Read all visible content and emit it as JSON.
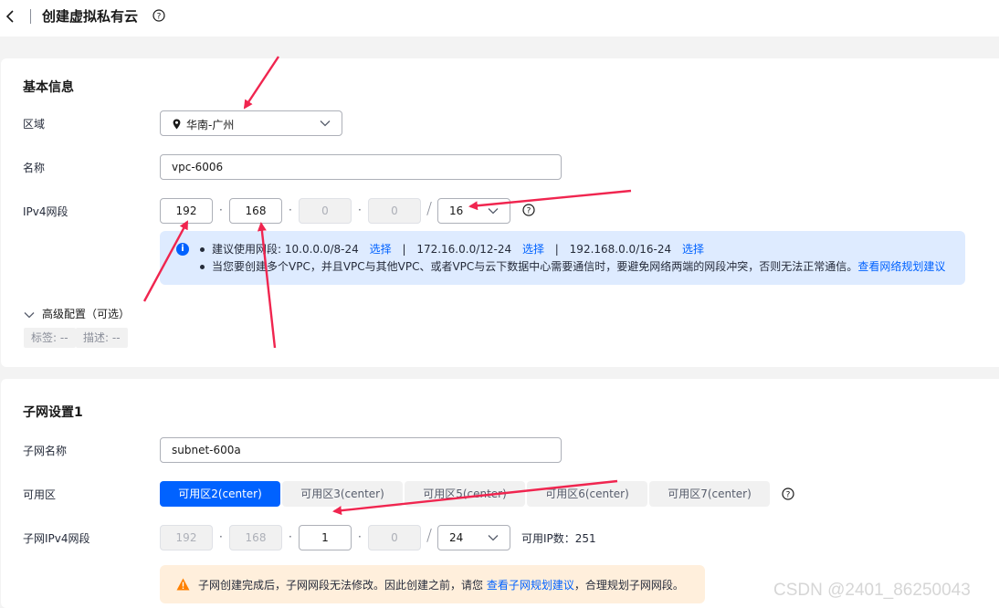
{
  "header": {
    "title": "创建虚拟私有云"
  },
  "basic": {
    "section_title": "基本信息",
    "region_label": "区域",
    "region_value": "华南-广州",
    "name_label": "名称",
    "name_value": "vpc-6006",
    "ipv4_label": "IPv4网段",
    "octets": [
      "192",
      "168",
      "0",
      "0"
    ],
    "mask": "16",
    "info": {
      "line1_prefix": "建议使用网段: 10.0.0.0/8-24",
      "select_label": "选择",
      "range2": "172.16.0.0/12-24",
      "range3": "192.168.0.0/16-24",
      "separator": "|",
      "line2_text": "当您要创建多个VPC，并且VPC与其他VPC、或者VPC与云下数据中心需要通信时，要避免网络两端的网段冲突，否则无法正常通信。",
      "line2_link": "查看网络规划建议"
    },
    "advanced_label": "高级配置（可选）",
    "tag_chip": "标签: --",
    "desc_chip": "描述: --"
  },
  "subnet": {
    "section_title": "子网设置1",
    "name_label": "子网名称",
    "name_value": "subnet-600a",
    "az_label": "可用区",
    "zones": [
      "可用区2(center)",
      "可用区3(center)",
      "可用区5(center)",
      "可用区6(center)",
      "可用区7(center)"
    ],
    "ipv4_label": "子网IPv4网段",
    "octets": [
      "192",
      "168",
      "1",
      "0"
    ],
    "mask": "24",
    "available_ip": "可用IP数：251",
    "warn_prefix": "子网创建完成后，子网网段无法修改。因此创建之前，请您",
    "warn_link": "查看子网规划建议",
    "warn_suffix": "，合理规划子网网段。"
  },
  "octet_separator": "·",
  "watermark": "CSDN @2401_86250043",
  "colors": {
    "accent": "#0062ff",
    "arrow": "#f0254f",
    "info_bg": "#deebff",
    "warn_bg": "#ffefdc"
  }
}
